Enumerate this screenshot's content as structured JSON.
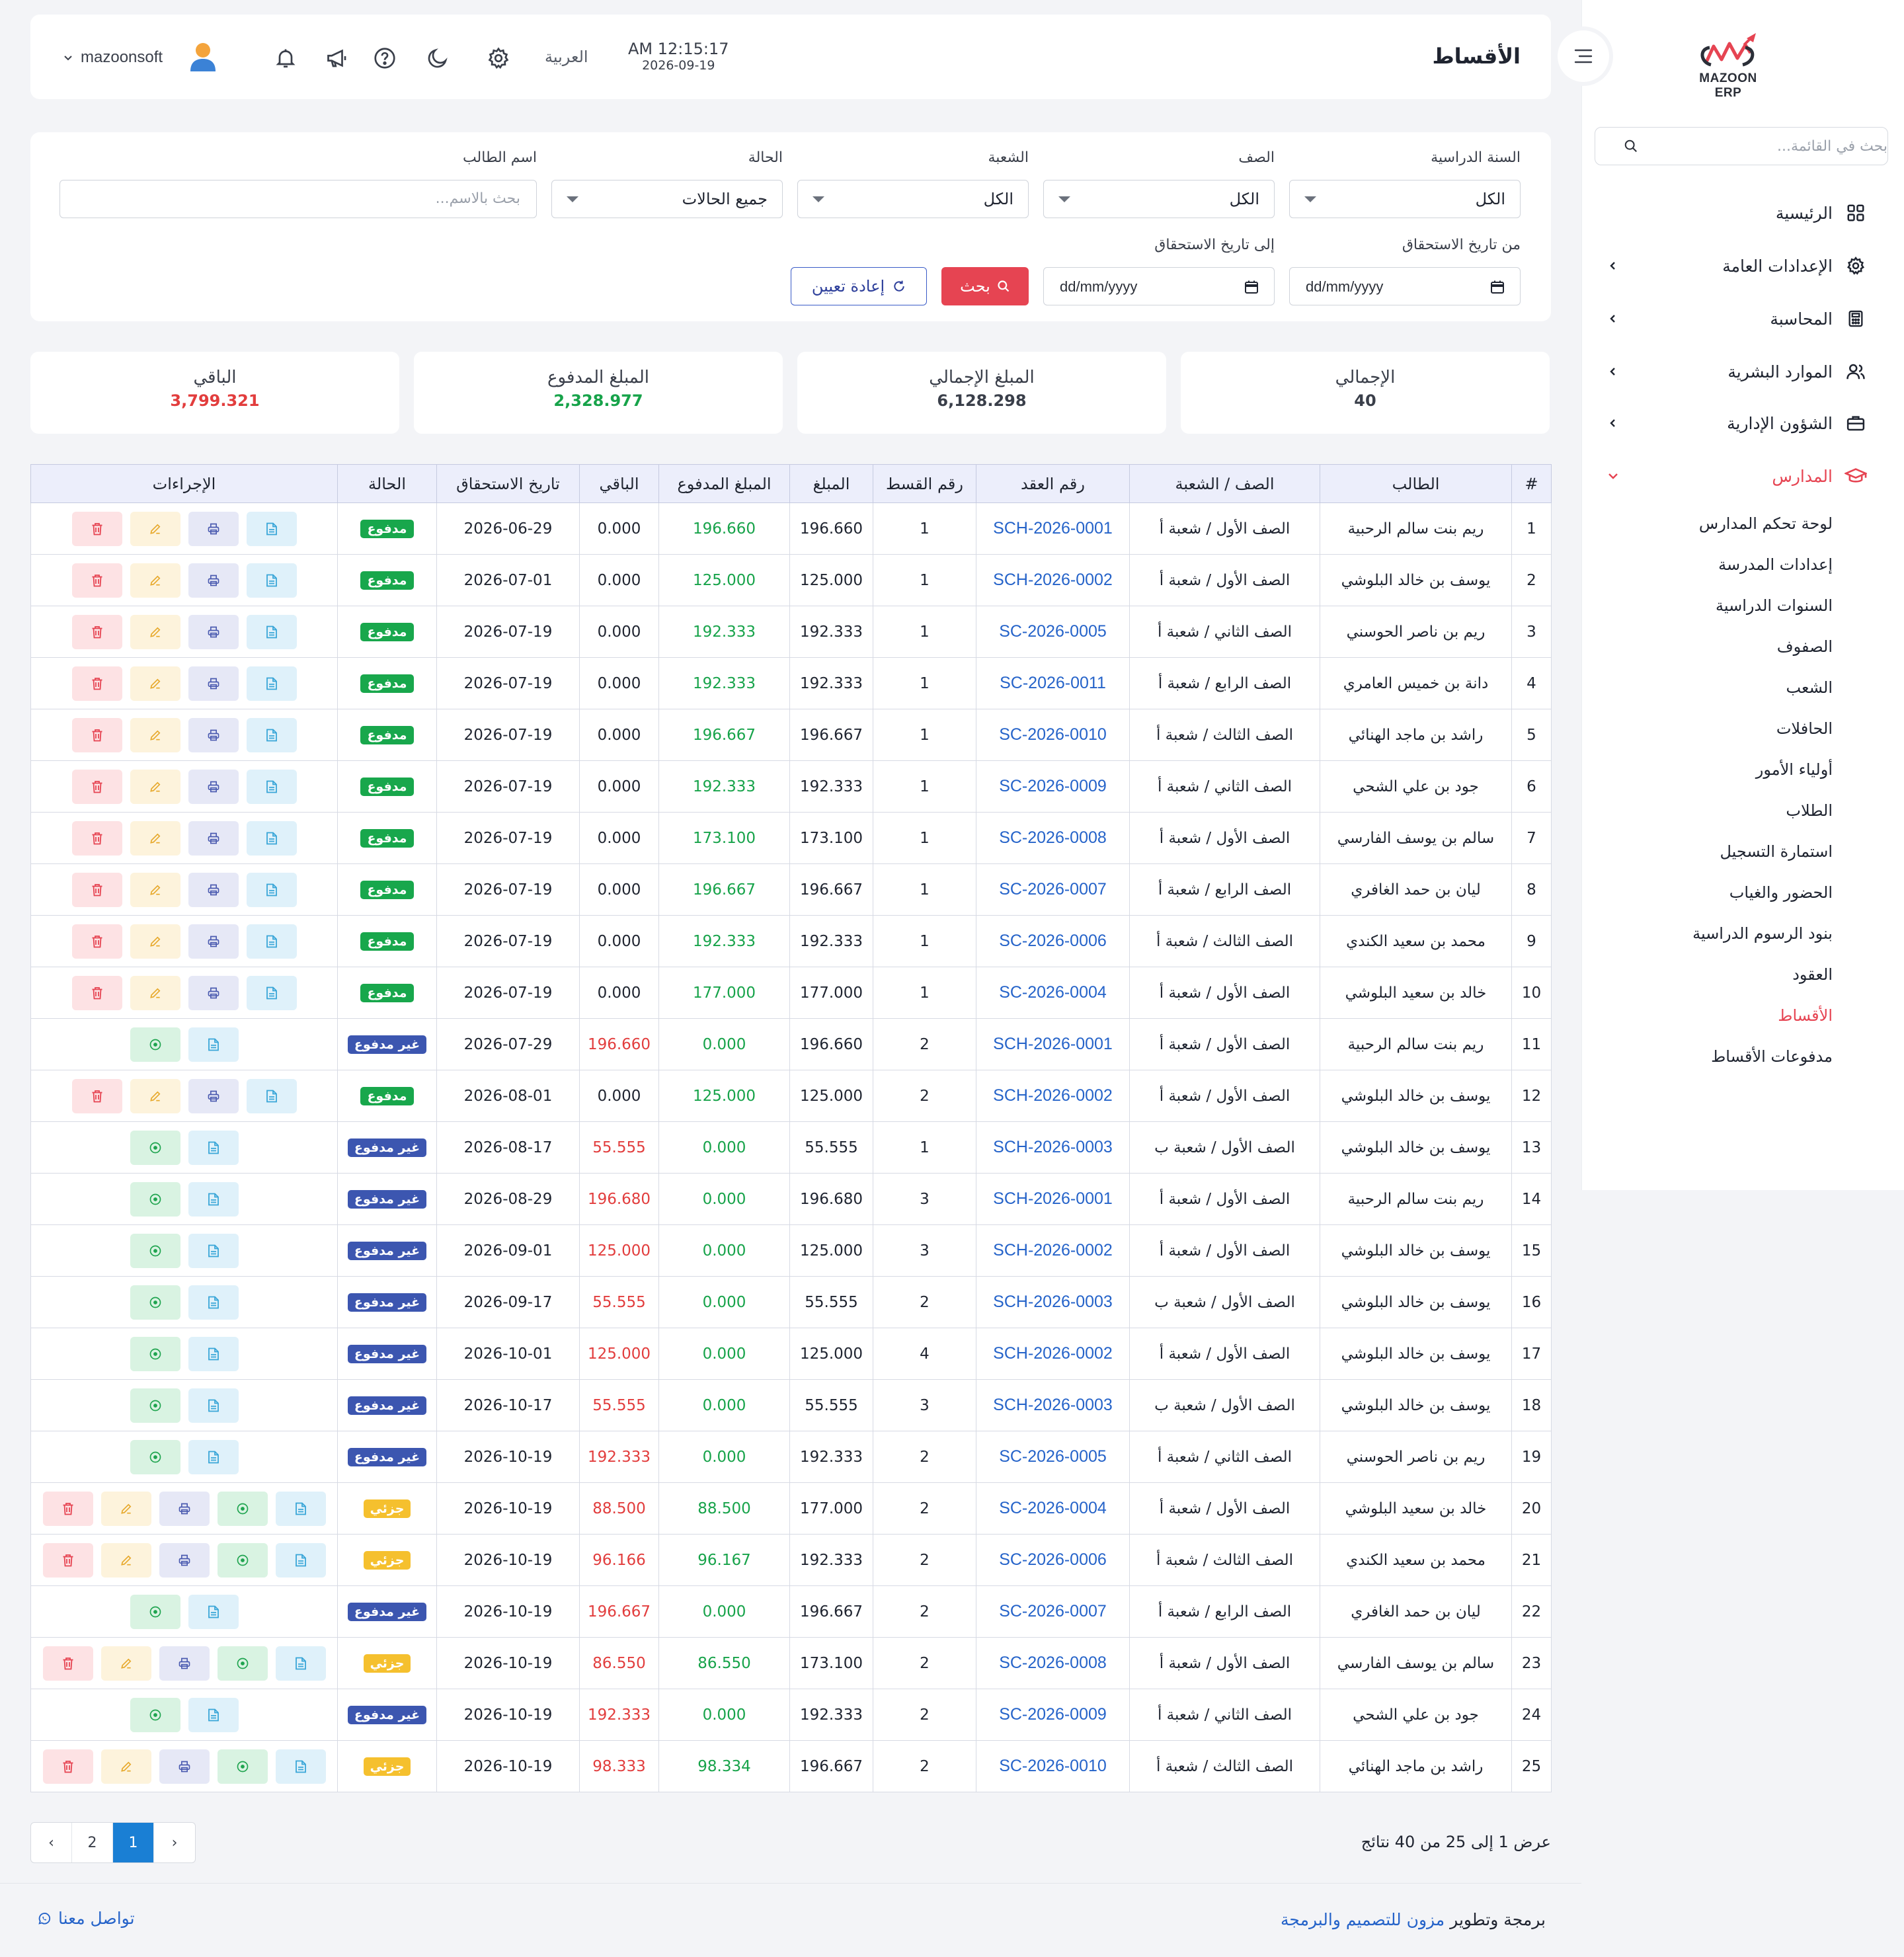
{
  "app": {
    "brand": "MAZOON ERP",
    "logo_subtext": "ERP"
  },
  "sidebar": {
    "search_placeholder": "بحث في القائمة...",
    "items": [
      {
        "label": "الرئيسية",
        "icon": "grid-icon",
        "has_children": false
      },
      {
        "label": "الإعدادات العامة",
        "icon": "gear-icon",
        "has_children": true
      },
      {
        "label": "المحاسبة",
        "icon": "calculator-icon",
        "has_children": true
      },
      {
        "label": "الموارد البشرية",
        "icon": "users-icon",
        "has_children": true
      },
      {
        "label": "الشؤون الإدارية",
        "icon": "briefcase-icon",
        "has_children": true
      },
      {
        "label": "المدارس",
        "icon": "graduation-cap-icon",
        "has_children": true,
        "expanded": true
      }
    ],
    "sub_items": [
      "لوحة تحكم المدارس",
      "إعدادات المدرسة",
      "السنوات الدراسية",
      "الصفوف",
      "الشعب",
      "الحافلات",
      "أولياء الأمور",
      "الطلاب",
      "استمارة التسجيل",
      "الحضور والغياب",
      "بنود الرسوم الدراسية",
      "العقود",
      "الأقساط",
      "مدفوعات الأقساط"
    ],
    "active_sub": "الأقساط"
  },
  "header": {
    "title": "الأقساط",
    "time": "AM 12:15:17",
    "date": "2026-09-19",
    "language": "العربية",
    "username": "mazoonsoft"
  },
  "filters": {
    "year_label": "السنة الدراسية",
    "year_value": "الكل",
    "class_label": "الصف",
    "class_value": "الكل",
    "section_label": "الشعبة",
    "section_value": "الكل",
    "status_label": "الحالة",
    "status_value": "جميع الحالات",
    "student_label": "اسم الطالب",
    "student_placeholder": "بحث بالاسم...",
    "from_label": "من تاريخ الاستحقاق",
    "from_value": "dd/mm/yyyy",
    "to_label": "إلى تاريخ الاستحقاق",
    "to_value": "dd/mm/yyyy",
    "search_btn": "بحث",
    "reset_btn": "إعادة تعيين"
  },
  "stats": {
    "total_label": "الإجمالي",
    "total_value": "40",
    "amount_label": "المبلغ الإجمالي",
    "amount_value": "6,128.298",
    "paid_label": "المبلغ المدفوع",
    "paid_value": "2,328.977",
    "remaining_label": "الباقي",
    "remaining_value": "3,799.321",
    "colors": {
      "paid": "#17a34a",
      "remaining": "#e23d3d"
    }
  },
  "table": {
    "columns": [
      "#",
      "الطالب",
      "الصف / الشعبة",
      "رقم العقد",
      "رقم القسط",
      "المبلغ",
      "المبلغ المدفوع",
      "الباقي",
      "تاريخ الاستحقاق",
      "الحالة",
      "الإجراءات"
    ],
    "rows": [
      [
        "1",
        "ريم بنت سالم الرحبية",
        "الصف الأول / شعبة أ",
        "SCH-2026-0001",
        "1",
        "196.660",
        "196.660",
        "0.000",
        "2026-06-29",
        "مدفوع"
      ],
      [
        "2",
        "يوسف بن خالد البلوشي",
        "الصف الأول / شعبة أ",
        "SCH-2026-0002",
        "1",
        "125.000",
        "125.000",
        "0.000",
        "2026-07-01",
        "مدفوع"
      ],
      [
        "3",
        "ريم بن ناصر الحوسني",
        "الصف الثاني / شعبة أ",
        "SC-2026-0005",
        "1",
        "192.333",
        "192.333",
        "0.000",
        "2026-07-19",
        "مدفوع"
      ],
      [
        "4",
        "دانة بن خميس العامري",
        "الصف الرابع / شعبة أ",
        "SC-2026-0011",
        "1",
        "192.333",
        "192.333",
        "0.000",
        "2026-07-19",
        "مدفوع"
      ],
      [
        "5",
        "راشد بن ماجد الهنائي",
        "الصف الثالث / شعبة أ",
        "SC-2026-0010",
        "1",
        "196.667",
        "196.667",
        "0.000",
        "2026-07-19",
        "مدفوع"
      ],
      [
        "6",
        "جود بن علي الشحي",
        "الصف الثاني / شعبة أ",
        "SC-2026-0009",
        "1",
        "192.333",
        "192.333",
        "0.000",
        "2026-07-19",
        "مدفوع"
      ],
      [
        "7",
        "سالم بن يوسف الفارسي",
        "الصف الأول / شعبة أ",
        "SC-2026-0008",
        "1",
        "173.100",
        "173.100",
        "0.000",
        "2026-07-19",
        "مدفوع"
      ],
      [
        "8",
        "ليان بن حمد الغافري",
        "الصف الرابع / شعبة أ",
        "SC-2026-0007",
        "1",
        "196.667",
        "196.667",
        "0.000",
        "2026-07-19",
        "مدفوع"
      ],
      [
        "9",
        "محمد بن سعيد الكندي",
        "الصف الثالث / شعبة أ",
        "SC-2026-0006",
        "1",
        "192.333",
        "192.333",
        "0.000",
        "2026-07-19",
        "مدفوع"
      ],
      [
        "10",
        "خالد بن سعيد البلوشي",
        "الصف الأول / شعبة أ",
        "SC-2026-0004",
        "1",
        "177.000",
        "177.000",
        "0.000",
        "2026-07-19",
        "مدفوع"
      ],
      [
        "11",
        "ريم بنت سالم الرحبية",
        "الصف الأول / شعبة أ",
        "SCH-2026-0001",
        "2",
        "196.660",
        "0.000",
        "196.660",
        "2026-07-29",
        "غير مدفوع"
      ],
      [
        "12",
        "يوسف بن خالد البلوشي",
        "الصف الأول / شعبة أ",
        "SCH-2026-0002",
        "2",
        "125.000",
        "125.000",
        "0.000",
        "2026-08-01",
        "مدفوع"
      ],
      [
        "13",
        "يوسف بن خالد البلوشي",
        "الصف الأول / شعبة ب",
        "SCH-2026-0003",
        "1",
        "55.555",
        "0.000",
        "55.555",
        "2026-08-17",
        "غير مدفوع"
      ],
      [
        "14",
        "ريم بنت سالم الرحبية",
        "الصف الأول / شعبة أ",
        "SCH-2026-0001",
        "3",
        "196.680",
        "0.000",
        "196.680",
        "2026-08-29",
        "غير مدفوع"
      ],
      [
        "15",
        "يوسف بن خالد البلوشي",
        "الصف الأول / شعبة أ",
        "SCH-2026-0002",
        "3",
        "125.000",
        "0.000",
        "125.000",
        "2026-09-01",
        "غير مدفوع"
      ],
      [
        "16",
        "يوسف بن خالد البلوشي",
        "الصف الأول / شعبة ب",
        "SCH-2026-0003",
        "2",
        "55.555",
        "0.000",
        "55.555",
        "2026-09-17",
        "غير مدفوع"
      ],
      [
        "17",
        "يوسف بن خالد البلوشي",
        "الصف الأول / شعبة أ",
        "SCH-2026-0002",
        "4",
        "125.000",
        "0.000",
        "125.000",
        "2026-10-01",
        "غير مدفوع"
      ],
      [
        "18",
        "يوسف بن خالد البلوشي",
        "الصف الأول / شعبة ب",
        "SCH-2026-0003",
        "3",
        "55.555",
        "0.000",
        "55.555",
        "2026-10-17",
        "غير مدفوع"
      ],
      [
        "19",
        "ريم بن ناصر الحوسني",
        "الصف الثاني / شعبة أ",
        "SC-2026-0005",
        "2",
        "192.333",
        "0.000",
        "192.333",
        "2026-10-19",
        "غير مدفوع"
      ],
      [
        "20",
        "خالد بن سعيد البلوشي",
        "الصف الأول / شعبة أ",
        "SC-2026-0004",
        "2",
        "177.000",
        "88.500",
        "88.500",
        "2026-10-19",
        "جزئي"
      ],
      [
        "21",
        "محمد بن سعيد الكندي",
        "الصف الثالث / شعبة أ",
        "SC-2026-0006",
        "2",
        "192.333",
        "96.167",
        "96.166",
        "2026-10-19",
        "جزئي"
      ],
      [
        "22",
        "ليان بن حمد الغافري",
        "الصف الرابع / شعبة أ",
        "SC-2026-0007",
        "2",
        "196.667",
        "0.000",
        "196.667",
        "2026-10-19",
        "غير مدفوع"
      ],
      [
        "23",
        "سالم بن يوسف الفارسي",
        "الصف الأول / شعبة أ",
        "SC-2026-0008",
        "2",
        "173.100",
        "86.550",
        "86.550",
        "2026-10-19",
        "جزئي"
      ],
      [
        "24",
        "جود بن علي الشحي",
        "الصف الثاني / شعبة أ",
        "SC-2026-0009",
        "2",
        "192.333",
        "0.000",
        "192.333",
        "2026-10-19",
        "غير مدفوع"
      ],
      [
        "25",
        "راشد بن ماجد الهنائي",
        "الصف الثالث / شعبة أ",
        "SC-2026-0010",
        "2",
        "196.667",
        "98.334",
        "98.333",
        "2026-10-19",
        "جزئي"
      ]
    ],
    "status_colors": {
      "مدفوع": "#18a74c",
      "غير مدفوع": "#3c56b0",
      "جزئي": "#f5c02e"
    }
  },
  "pagination": {
    "pages": [
      "‹",
      "2",
      "1",
      "›"
    ],
    "active": "1",
    "showing_text": "عرض 1 إلى 25 من 40 نتائج"
  },
  "footer": {
    "credit_prefix": "برمجة وتطوير",
    "credit_link": "مزون للتصميم والبرمجة",
    "contact": "تواصل معنا"
  }
}
